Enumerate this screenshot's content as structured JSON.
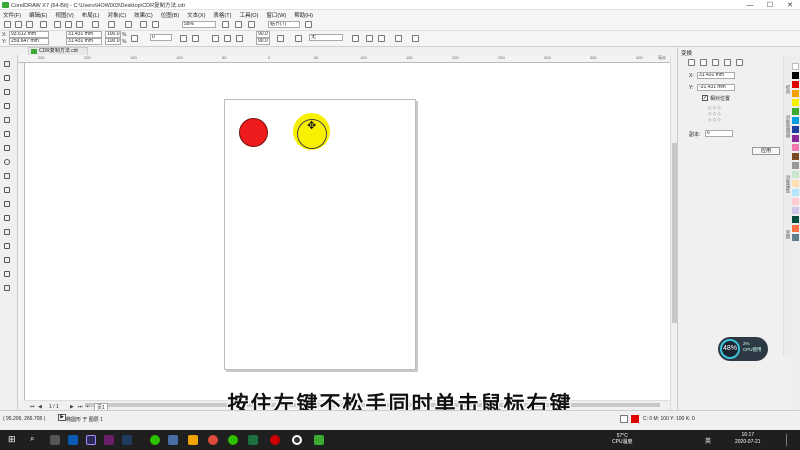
{
  "window": {
    "title": "CorelDRAW X7 (64-Bit) - C:\\Users\\HOW003\\Desktop\\CDR复制方法.cdr",
    "min": "—",
    "max": "☐",
    "close": "✕"
  },
  "menu": [
    "文件(F)",
    "编辑(E)",
    "视图(V)",
    "布局(L)",
    "对象(C)",
    "效果(C)",
    "位图(B)",
    "文本(X)",
    "表格(T)",
    "工具(O)",
    "窗口(W)",
    "帮助(H)"
  ],
  "toolbar1": {
    "zoom": "58%",
    "snap": "贴齐(T)"
  },
  "propbar": {
    "x_label": "X:",
    "x_value": "93.612 mm",
    "y_label": "Y:",
    "y_value": "259.647 mm",
    "w_value": "31.431 mm",
    "h_value": "31.431 mm",
    "scale_w": "100.0",
    "scale_h": "100.0",
    "pct": "%",
    "rotate": "0",
    "angle1": "90.0",
    "angle2": "90.0",
    "outline": "无"
  },
  "doc_tab": "CDR复制方法.cdr",
  "ruler": {
    "h_ticks": [
      "250",
      "200",
      "150",
      "100",
      "50",
      "0",
      "50",
      "100",
      "150",
      "200",
      "250",
      "300",
      "350",
      "400"
    ],
    "unit": "毫米"
  },
  "canvas": {
    "red_circle_color": "#ee1c1c",
    "yellow_circle_color": "#f8f000",
    "cursor": "✥"
  },
  "transform_panel": {
    "title": "变换",
    "x_label": "X:",
    "x_value": "31.431 mm",
    "y_label": "Y:",
    "y_value": "-31.431 mm",
    "relative_label": "相对位置",
    "copies_label": "副本:",
    "copies_value": "6",
    "apply_button": "应用"
  },
  "docker_tabs": [
    "提示",
    "对象管理器",
    "对象属性",
    "变换"
  ],
  "palette": [
    "#ffffff",
    "#000000",
    "#e00000",
    "#f4a000",
    "#f8f000",
    "#3aaa35",
    "#00a0e0",
    "#1d3fa0",
    "#8b2a9a",
    "#f07ab0",
    "#7a4a20",
    "#9a9a9a",
    "#c8e6c9",
    "#ffe0b2",
    "#b3e5fc",
    "#ffcdd2",
    "#d1c4e9",
    "#004d40",
    "#ff7043",
    "#607d8b"
  ],
  "page_nav": {
    "counter": "1 / 1",
    "page_tab": "页1"
  },
  "status": {
    "coords": "( 95.206, 266.708 )",
    "object_info": "椭圆形 于 图层 1",
    "fill_info": "C: 0 M: 100 Y: 100 K: 0"
  },
  "cpu_widget": {
    "percent": "48%",
    "sub_pct": "2%",
    "sub_label": "CPU使用"
  },
  "subtitle": "按住左键不松手同时单击鼠标右键",
  "taskbar": {
    "temp": "57°C",
    "temp_label": "CPU温度",
    "time": "16:17",
    "date": "2020-07-21",
    "lang": "英"
  }
}
